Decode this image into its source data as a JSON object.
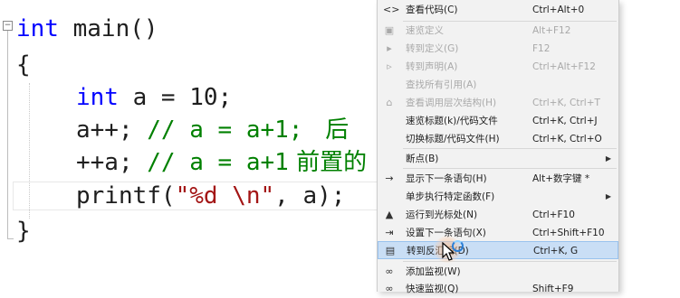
{
  "editor": {
    "lines": {
      "l1_kw": "int",
      "l1_rest": " main()",
      "l2": "{",
      "l3_kw": "int",
      "l3_rest": " a = 10;",
      "l4_code": "a++;",
      "l4_comment": " // a = a+1;",
      "l4_comment_cn": "   后",
      "l5_code": "++a;",
      "l5_comment": " // a = a+1",
      "l5_comment_cn": " 前置的",
      "l6_fn": "printf(",
      "l6_str": "\"%d \\n\"",
      "l6_rest": ", a);",
      "l7": "}"
    },
    "collapse_symbol": "−"
  },
  "context_menu": {
    "items": [
      {
        "icon": "<>",
        "label": "查看代码(C)",
        "shortcut": "Ctrl+Alt+0"
      },
      {
        "icon": "▣",
        "label": "速览定义",
        "shortcut": "Alt+F12"
      },
      {
        "icon": "▸",
        "label": "转到定义(G)",
        "shortcut": "F12"
      },
      {
        "icon": "▹",
        "label": "转到声明(A)",
        "shortcut": "Ctrl+Alt+F12"
      },
      {
        "icon": "",
        "label": "查找所有引用(A)",
        "shortcut": ""
      },
      {
        "icon": "⌂",
        "label": "查看调用层次结构(H)",
        "shortcut": "Ctrl+K, Ctrl+T"
      },
      {
        "icon": "",
        "label": "速览标题(k)/代码文件",
        "shortcut": "Ctrl+K, Ctrl+J"
      },
      {
        "icon": "",
        "label": "切换标题/代码文件(H)",
        "shortcut": "Ctrl+K, Ctrl+O"
      },
      {
        "icon": "",
        "label": "断点(B)",
        "shortcut": ""
      },
      {
        "icon": "→",
        "label": "显示下一条语句(H)",
        "shortcut": "Alt+数字键 *"
      },
      {
        "icon": "",
        "label": "单步执行特定函数(F)",
        "shortcut": ""
      },
      {
        "icon": "▲",
        "label": "运行到光标处(N)",
        "shortcut": "Ctrl+F10"
      },
      {
        "icon": "⇥",
        "label": "设置下一条语句(X)",
        "shortcut": "Ctrl+Shift+F10"
      },
      {
        "icon": "▤",
        "label": "转到反汇编(D)",
        "shortcut": "Ctrl+K, G"
      },
      {
        "icon": "∞",
        "label": "添加监视(W)",
        "shortcut": ""
      },
      {
        "icon": "∞",
        "label": "快速监视(Q)",
        "shortcut": "Shift+F9"
      }
    ],
    "submenu_arrow": "▶"
  }
}
